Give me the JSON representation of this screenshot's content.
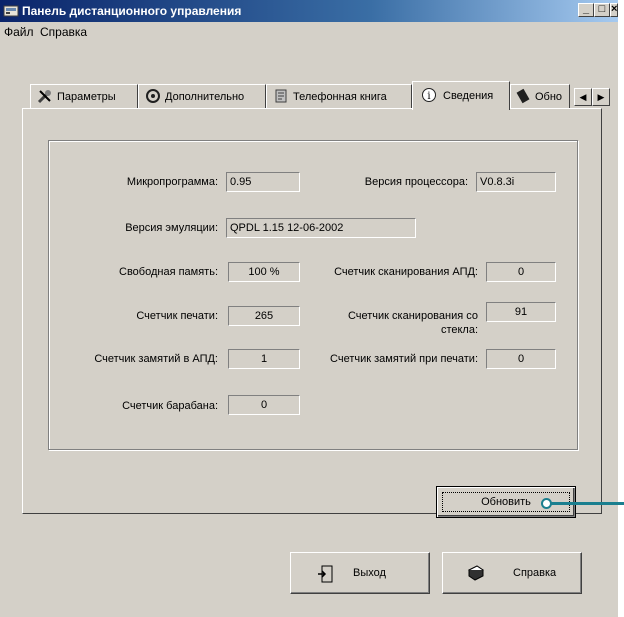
{
  "window": {
    "title": "Панель дистанционного управления"
  },
  "menu": {
    "file": "Файл",
    "help": "Справка"
  },
  "tabs": [
    {
      "label": "Параметры",
      "icon": "tools-icon"
    },
    {
      "label": "Дополнительно",
      "icon": "gear-icon"
    },
    {
      "label": "Телефонная книга",
      "icon": "phonebook-icon"
    },
    {
      "label": "Сведения",
      "icon": "info-icon",
      "active": true
    },
    {
      "label": "Обно",
      "icon": "update-icon"
    }
  ],
  "info": {
    "firmware_label": "Микропрограмма:",
    "firmware_value": "0.95",
    "cpu_label": "Версия процессора:",
    "cpu_value": "V0.8.3i",
    "emulation_label": "Версия эмуляции:",
    "emulation_value": "QPDL 1.15 12-06-2002",
    "free_mem_label": "Свободная память:",
    "free_mem_value": "100 %",
    "adf_scan_label": "Счетчик сканирования АПД:",
    "adf_scan_value": "0",
    "print_count_label": "Счетчик печати:",
    "print_count_value": "265",
    "glass_scan_label_1": "Счетчик сканирования со",
    "glass_scan_label_2": "стекла:",
    "glass_scan_value": "91",
    "adf_jam_label": "Счетчик замятий в АПД:",
    "adf_jam_value": "1",
    "print_jam_label": "Счетчик замятий при печати:",
    "print_jam_value": "0",
    "drum_label": "Счетчик барабана:",
    "drum_value": "0"
  },
  "buttons": {
    "refresh": "Обновить",
    "exit": "Выход",
    "help": "Справка"
  },
  "colors": {
    "face": "#d4d0c8",
    "title_start": "#0a246a",
    "callout": "#1a7f8f"
  }
}
